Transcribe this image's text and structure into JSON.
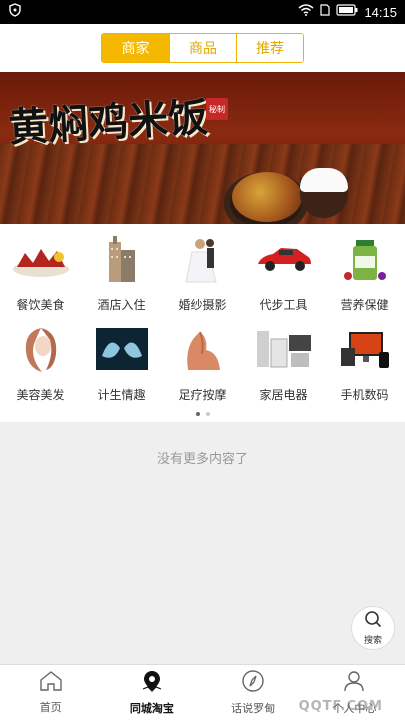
{
  "status_bar": {
    "time": "14:15"
  },
  "top_tabs": [
    {
      "label": "商家",
      "active": true
    },
    {
      "label": "商品",
      "active": false
    },
    {
      "label": "推荐",
      "active": false
    }
  ],
  "banner": {
    "title": "黄焖鸡米饭",
    "stamp": "秘制"
  },
  "categories": [
    {
      "label": "餐饮美食",
      "icon": "food-icon"
    },
    {
      "label": "酒店入住",
      "icon": "hotel-icon"
    },
    {
      "label": "婚纱摄影",
      "icon": "wedding-icon"
    },
    {
      "label": "代步工具",
      "icon": "car-icon"
    },
    {
      "label": "营养保健",
      "icon": "supplement-icon"
    },
    {
      "label": "美容美发",
      "icon": "beauty-icon"
    },
    {
      "label": "计生情趣",
      "icon": "xray-icon"
    },
    {
      "label": "足疗按摩",
      "icon": "massage-icon"
    },
    {
      "label": "家居电器",
      "icon": "appliance-icon"
    },
    {
      "label": "手机数码",
      "icon": "digital-icon"
    }
  ],
  "pager": {
    "pages": 2,
    "current": 1
  },
  "empty_message": "没有更多内容了",
  "fab": {
    "label": "搜索"
  },
  "bottom_nav": [
    {
      "label": "首页",
      "active": false
    },
    {
      "label": "同城淘宝",
      "active": true
    },
    {
      "label": "话说罗甸",
      "active": false
    },
    {
      "label": "个人中心",
      "active": false
    }
  ],
  "watermark": "QQTF.COM"
}
